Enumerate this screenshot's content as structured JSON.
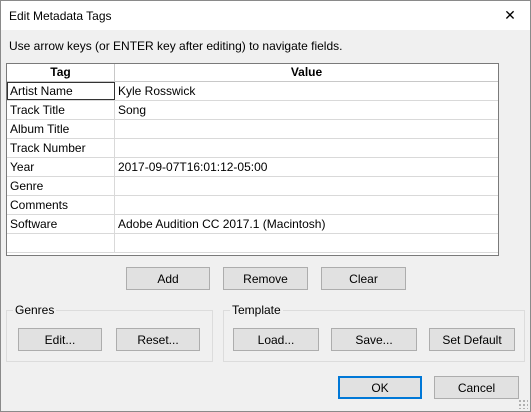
{
  "window": {
    "title": "Edit Metadata Tags",
    "close_glyph": "✕"
  },
  "instructions": "Use arrow keys (or ENTER key after editing) to navigate fields.",
  "table": {
    "headers": {
      "tag": "Tag",
      "value": "Value"
    },
    "rows": [
      {
        "tag": "Artist Name",
        "value": "Kyle Rosswick"
      },
      {
        "tag": "Track Title",
        "value": "Song"
      },
      {
        "tag": "Album Title",
        "value": ""
      },
      {
        "tag": "Track Number",
        "value": ""
      },
      {
        "tag": "Year",
        "value": "2017-09-07T16:01:12-05:00"
      },
      {
        "tag": "Genre",
        "value": ""
      },
      {
        "tag": "Comments",
        "value": ""
      },
      {
        "tag": "Software",
        "value": "Adobe Audition CC 2017.1 (Macintosh)"
      },
      {
        "tag": "",
        "value": ""
      }
    ]
  },
  "actions": {
    "add": "Add",
    "remove": "Remove",
    "clear": "Clear"
  },
  "genres": {
    "label": "Genres",
    "edit": "Edit...",
    "reset": "Reset..."
  },
  "template": {
    "label": "Template",
    "load": "Load...",
    "save": "Save...",
    "set_default": "Set Default"
  },
  "footer": {
    "ok": "OK",
    "cancel": "Cancel"
  },
  "colors": {
    "accent": "#0078d7",
    "background": "#f0f0f0"
  }
}
